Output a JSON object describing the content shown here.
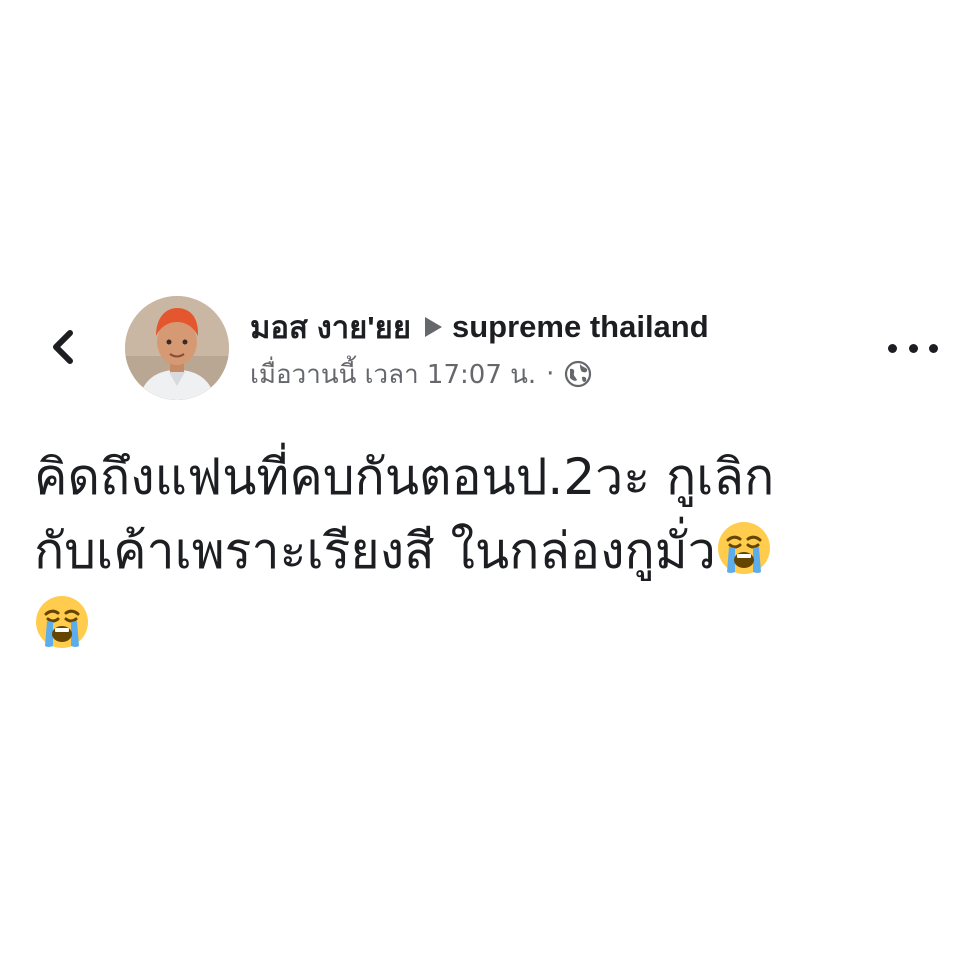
{
  "header": {
    "back_icon": "chevron-left-icon",
    "author_name": "มอส งาย'ยย",
    "share_arrow_icon": "triangle-right-icon",
    "group_name": "supreme thailand",
    "timestamp": "เมื่อวานนี้ เวลา 17:07 น.",
    "separator": "·",
    "privacy_icon": "globe-icon",
    "more_icon": "more-horizontal-icon"
  },
  "post": {
    "lines": [
      "คิดถึงแฟนที่คบกันตอนป.2วะ กูเลิก",
      "กับเค้าเพราะเรียงสี ในกล่องกูมั่ว"
    ],
    "emoji_icon": "loudly-crying-face-icon",
    "emoji_count": 2
  },
  "colors": {
    "text": "#1c1e21",
    "secondary_text": "#65676b",
    "emoji_face": "#ffcc4d",
    "emoji_tears": "#5dadec"
  }
}
